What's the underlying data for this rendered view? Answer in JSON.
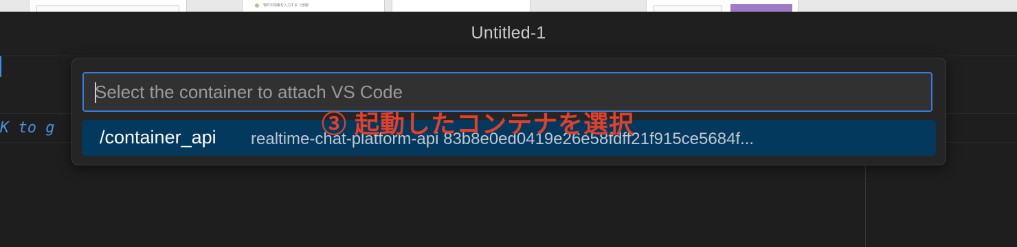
{
  "window": {
    "title": "Untitled-1"
  },
  "thumbnail_strip": {
    "caption_text": "物件の情報を入力する（仕組）"
  },
  "editor": {
    "hint_fragment": "K to g"
  },
  "quick_pick": {
    "placeholder": "Select the container to attach VS Code",
    "items": [
      {
        "label": "/container_api",
        "description": "realtime-chat-platform-api 83b8e0ed0419e26e58fdff21f915ce5684f...",
        "selected": true
      }
    ]
  },
  "annotation": {
    "text": "③ 起動したコンテナを選択",
    "color": "#e2402a"
  },
  "colors": {
    "focus_border": "#3a7bd5",
    "selection_bg": "#04395e",
    "background": "#1e1e1e"
  }
}
